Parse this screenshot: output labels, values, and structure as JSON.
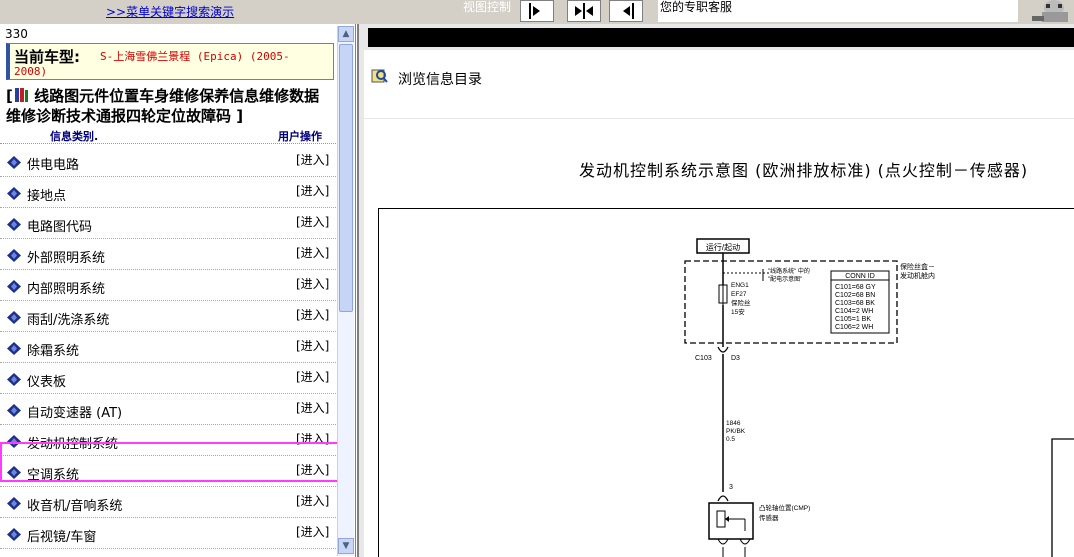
{
  "toolbar": {
    "search_link": ">>菜单关键字搜索演示",
    "view_label": "视图控制",
    "service_text": "您的专职客服"
  },
  "vehicle": {
    "count": "330",
    "label": "当前车型:",
    "value_line1": "S-上海雪佛兰景程 (Epica) (2005-",
    "value_line2": "2008)"
  },
  "nav_links": {
    "prefix": "[",
    "items": [
      "线路图",
      "元件位置",
      "车身维修",
      "保养信息",
      "维修数据",
      "维修诊断",
      "技术通报",
      "四轮定位",
      "故障码"
    ],
    "suffix": "]"
  },
  "list": {
    "header_category": "信息类别.",
    "header_ops": "用户操作",
    "action_label": "[进入]",
    "items": [
      "供电电路",
      "接地点",
      "电路图代码",
      "外部照明系统",
      "内部照明系统",
      "雨刮/洗涤系统",
      "除霜系统",
      "仪表板",
      "自动变速器 (AT)",
      "发动机控制系统",
      "空调系统",
      "收音机/音响系统",
      "后视镜/车窗"
    ],
    "highlighted_item": "发动机控制系统"
  },
  "right": {
    "browse_title": "浏览信息目录",
    "diagram_title": "发动机控制系统示意图 (欧洲排放标准) (点火控制－传感器)"
  },
  "diagram": {
    "run_start": "运行/起动",
    "fuse_box": "保险丝盒－",
    "engine_compartment": "发动机舱内",
    "note_line1": "\"线路系统\" 中的",
    "note_line2": "\"配电示意图\"",
    "conn_header": "CONN ID",
    "conn_rows": [
      "C101=68 GY",
      "C102=68 BN",
      "C103=68 BK",
      "C104=2 WH",
      "C105=1 BK",
      "C106=2 WH"
    ],
    "fuse_id1": "ENG1",
    "fuse_id2": "EF27",
    "fuse_label": "保险丝",
    "fuse_rating": "15安",
    "connector": "C103",
    "pin": "D3",
    "wire_id": "1846",
    "wire_color": "PK/BK",
    "wire_size": "0.5",
    "sensor_pin": "3",
    "sensor_name": "凸轮轴位置(CMP)",
    "sensor_label": "传感器"
  },
  "colors": {
    "highlight_border": "#ff3bff",
    "vehicle_value": "#d40000",
    "link": "#0000cc"
  }
}
